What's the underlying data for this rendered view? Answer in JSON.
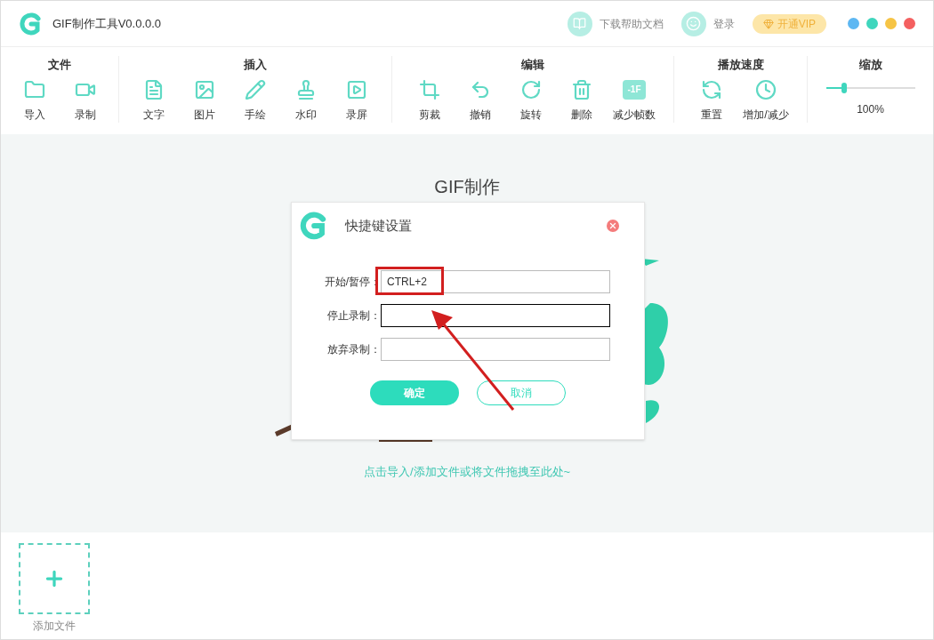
{
  "window": {
    "title": "GIF制作工具V0.0.0.0",
    "help": "下载帮助文档",
    "login": "登录",
    "vip": "开通VIP"
  },
  "toolbar": [
    {
      "title": "文件",
      "items": [
        {
          "kind": "folder",
          "label": "导入"
        },
        {
          "kind": "video",
          "label": "录制"
        }
      ]
    },
    {
      "title": "插入",
      "items": [
        {
          "kind": "text",
          "label": "文字"
        },
        {
          "kind": "image",
          "label": "图片"
        },
        {
          "kind": "pen",
          "label": "手绘"
        },
        {
          "kind": "stamp",
          "label": "水印"
        },
        {
          "kind": "screen",
          "label": "录屏"
        }
      ]
    },
    {
      "title": "编辑",
      "items": [
        {
          "kind": "crop",
          "label": "剪裁"
        },
        {
          "kind": "undo",
          "label": "撤销"
        },
        {
          "kind": "rotate",
          "label": "旋转"
        },
        {
          "kind": "trash",
          "label": "删除"
        },
        {
          "kind": "frames",
          "label": "减少帧数",
          "badge": "-1F"
        }
      ]
    },
    {
      "title": "播放速度",
      "items": [
        {
          "kind": "reset",
          "label": "重置"
        },
        {
          "kind": "clock",
          "label": "增加/减少"
        }
      ]
    }
  ],
  "zoom": {
    "title": "缩放",
    "level": 0.2,
    "reading": "100%"
  },
  "canvas": {
    "title": "GIF制作",
    "hint": "点击导入/添加文件或将文件拖拽至此处~"
  },
  "dialog": {
    "title": "快捷键设置",
    "fields": [
      {
        "label": "开始/暂停：",
        "value": "CTRL+2",
        "focused": false,
        "highlighted": true
      },
      {
        "label": "停止录制：",
        "focused": true,
        "highlighted": false
      },
      {
        "label": "放弃录制：",
        "focused": false,
        "highlighted": false
      }
    ],
    "ok": "确定",
    "cancel": "取消"
  },
  "add_file": {
    "label": "添加文件"
  }
}
